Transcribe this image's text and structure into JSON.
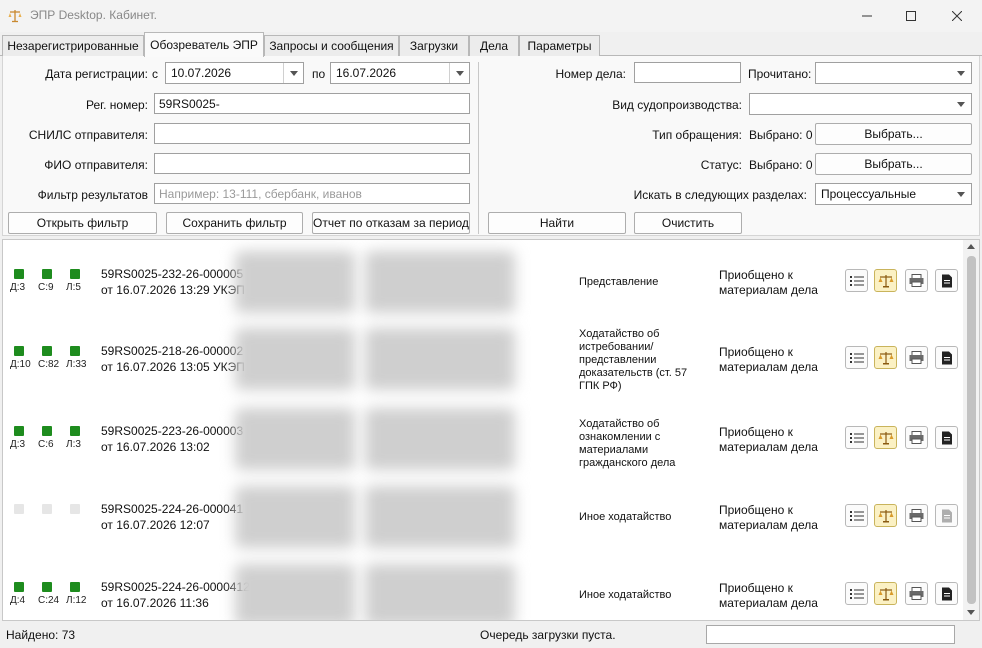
{
  "window": {
    "title": "ЭПР Desktop. Кабинет."
  },
  "tabs": [
    {
      "label": "Незарегистрированные"
    },
    {
      "label": "Обозреватель ЭПР"
    },
    {
      "label": "Запросы и сообщения"
    },
    {
      "label": "Загрузки"
    },
    {
      "label": "Дела"
    },
    {
      "label": "Параметры"
    }
  ],
  "active_tab": "Обозреватель ЭПР",
  "filter": {
    "reg_date_label": "Дата регистрации:",
    "from_label": "с",
    "date_from": "10.07.2026",
    "to_label": "по",
    "date_to": "16.07.2026",
    "reg_num_label": "Рег. номер:",
    "reg_num_value": "59RS0025-",
    "snils_label": "СНИЛС отправителя:",
    "snils_value": "",
    "fio_label": "ФИО отправителя:",
    "fio_value": "",
    "result_filter_label": "Фильтр результатов",
    "result_filter_placeholder": "Например: 13-111, сбербанк, иванов",
    "open_filter": "Открыть фильтр",
    "save_filter": "Сохранить фильтр",
    "report": "Отчет по отказам за период",
    "case_num_label": "Номер дела:",
    "case_num_value": "",
    "read_label": "Прочитано:",
    "read_value": "",
    "proc_type_label": "Вид судопроизводства:",
    "proc_type_value": "",
    "appeal_type_label": "Тип обращения:",
    "appeal_selected": "Выбрано: 0",
    "status_label": "Статус:",
    "status_selected": "Выбрано: 0",
    "choose": "Выбрать...",
    "search_in_label": "Искать в следующих разделах:",
    "search_in_value": "Процессуальные",
    "find": "Найти",
    "clear": "Очистить"
  },
  "results": [
    {
      "active": true,
      "d": "Д:3",
      "c": "С:9",
      "l": "Л:5",
      "number": "59RS0025-232-26-000005",
      "date": "от 16.07.2026 13:29 УКЭП",
      "type": "Представление",
      "status": "Приобщено к материалам дела"
    },
    {
      "active": true,
      "d": "Д:10",
      "c": "С:82",
      "l": "Л:33",
      "number": "59RS0025-218-26-000002",
      "date": "от 16.07.2026 13:05 УКЭП",
      "type": "Ходатайство об истребовании/ представлении доказательств (ст. 57 ГПК РФ)",
      "status": "Приобщено к материалам дела"
    },
    {
      "active": true,
      "d": "Д:3",
      "c": "С:6",
      "l": "Л:3",
      "number": "59RS0025-223-26-000003",
      "date": "от 16.07.2026 13:02",
      "type": "Ходатайство об ознакомлении с материалами гражданского дела",
      "status": "Приобщено к материалам дела"
    },
    {
      "active": false,
      "d": "",
      "c": "",
      "l": "",
      "number": "59RS0025-224-26-000041",
      "date": "от 16.07.2026 12:07",
      "type": "Иное ходатайство",
      "status": "Приобщено к материалам дела"
    },
    {
      "active": true,
      "d": "Д:4",
      "c": "С:24",
      "l": "Л:12",
      "number": "59RS0025-224-26-0000412",
      "date": "от 16.07.2026 11:36",
      "type": "Иное ходатайство",
      "status": "Приобщено к материалам дела"
    }
  ],
  "footer": {
    "found": "Найдено: 73",
    "queue": "Очередь загрузки пуста."
  },
  "colors": {
    "indicator_on": "#1e8c1e",
    "indicator_off": "#e6e6e6",
    "accent_button": "#fbf1c4"
  },
  "icons": [
    "list-icon",
    "court-scales-icon",
    "printer-icon",
    "document-icon"
  ]
}
